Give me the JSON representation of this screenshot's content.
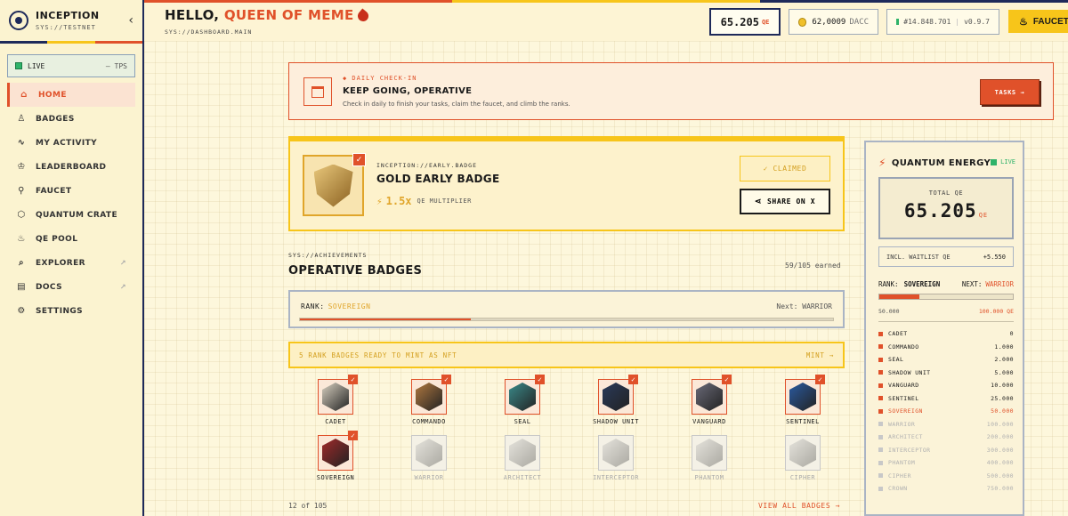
{
  "brand": {
    "title": "INCEPTION",
    "subtitle": "SYS://TESTNET",
    "collapse": "‹"
  },
  "colors": {
    "accent": "#e0512a",
    "gold": "#f7c51a",
    "navy": "#1e2a5a",
    "live": "#2fb36a"
  },
  "status": {
    "live": "LIVE",
    "tps": "— TPS"
  },
  "nav": [
    {
      "label": "HOME",
      "icon": "home-icon",
      "glyph": "⌂",
      "active": true,
      "external": false
    },
    {
      "label": "BADGES",
      "icon": "badge-icon",
      "glyph": "♙",
      "active": false,
      "external": false
    },
    {
      "label": "MY ACTIVITY",
      "icon": "activity-icon",
      "glyph": "∿",
      "active": false,
      "external": false
    },
    {
      "label": "LEADERBOARD",
      "icon": "trophy-icon",
      "glyph": "♔",
      "active": false,
      "external": false
    },
    {
      "label": "FAUCET",
      "icon": "faucet-icon",
      "glyph": "⚲",
      "active": false,
      "external": false
    },
    {
      "label": "QUANTUM CRATE",
      "icon": "cube-icon",
      "glyph": "⬡",
      "active": false,
      "external": false
    },
    {
      "label": "QE POOL",
      "icon": "flame-icon",
      "glyph": "♨",
      "active": false,
      "external": false
    },
    {
      "label": "EXPLORER",
      "icon": "search-icon",
      "glyph": "⌕",
      "active": false,
      "external": true
    },
    {
      "label": "DOCS",
      "icon": "docs-icon",
      "glyph": "▤",
      "active": false,
      "external": true
    },
    {
      "label": "SETTINGS",
      "icon": "gear-icon",
      "glyph": "⚙",
      "active": false,
      "external": false
    }
  ],
  "header": {
    "greeting": "HELLO,",
    "name": "QUEEN OF MEME",
    "path": "SYS://DASHBOARD.MAIN",
    "qe_value": "65.205",
    "qe_unit": "QE",
    "dacc_value": "62,0009",
    "dacc_label": "DACC",
    "block": "#14.848.701",
    "version": "v0.9.7",
    "faucet_label": "FAUCET"
  },
  "checkin": {
    "tag": "◆ DAILY CHECK-IN",
    "title": "KEEP GOING, OPERATIVE",
    "description": "Check in daily to finish your tasks, claim the faucet, and climb the ranks.",
    "button": "TASKS →"
  },
  "early_badge": {
    "path": "INCEPTION://EARLY.BADGE",
    "title": "GOLD EARLY BADGE",
    "multiplier": "1.5x",
    "multiplier_label": "QE MULTIPLIER",
    "claimed": "✓ CLAIMED",
    "share": "SHARE ON X"
  },
  "achievements": {
    "path": "SYS://ACHIEVEMENTS",
    "title": "OPERATIVE BADGES",
    "earned": "59/105 earned",
    "rank_label": "RANK:",
    "rank_value": "SOVEREIGN",
    "next": "Next: WARRIOR",
    "progress": 0.32,
    "mint_text": "5 RANK BADGES READY TO MINT AS NFT",
    "mint_action": "MINT →",
    "count": "12 of 105",
    "view_all": "VIEW ALL BADGES →",
    "badges": [
      {
        "name": "CADET",
        "earned": true,
        "color": "#d8d0c0"
      },
      {
        "name": "COMMANDO",
        "earned": true,
        "color": "#b07840"
      },
      {
        "name": "SEAL",
        "earned": true,
        "color": "#3a8a8a"
      },
      {
        "name": "SHADOW UNIT",
        "earned": true,
        "color": "#2a3a5a"
      },
      {
        "name": "VANGUARD",
        "earned": true,
        "color": "#6a6a78"
      },
      {
        "name": "SENTINEL",
        "earned": true,
        "color": "#2a5aa0"
      },
      {
        "name": "SOVEREIGN",
        "earned": true,
        "color": "#a02a2a"
      },
      {
        "name": "WARRIOR",
        "earned": false,
        "color": "#c8c8c8"
      },
      {
        "name": "ARCHITECT",
        "earned": false,
        "color": "#c8c8c8"
      },
      {
        "name": "INTERCEPTOR",
        "earned": false,
        "color": "#c8c8c8"
      },
      {
        "name": "PHANTOM",
        "earned": false,
        "color": "#c8c8c8"
      },
      {
        "name": "CIPHER",
        "earned": false,
        "color": "#c8c8c8"
      }
    ]
  },
  "quantum": {
    "title": "QUANTUM ENERGY",
    "live": "LIVE",
    "total_label": "TOTAL QE",
    "total_value": "65.205",
    "total_unit": "QE",
    "waitlist_label": "INCL. WAITLIST QE",
    "waitlist_value": "+5.550",
    "rank_label": "RANK:",
    "rank_value": "SOVEREIGN",
    "next_label": "NEXT:",
    "next_value": "WARRIOR",
    "progress": 0.3,
    "range_min": "50.000",
    "range_max": "100.000 QE",
    "tiers": [
      {
        "name": "CADET",
        "value": "0",
        "state": "done"
      },
      {
        "name": "COMMANDO",
        "value": "1.000",
        "state": "done"
      },
      {
        "name": "SEAL",
        "value": "2.000",
        "state": "done"
      },
      {
        "name": "SHADOW UNIT",
        "value": "5.000",
        "state": "done"
      },
      {
        "name": "VANGUARD",
        "value": "10.000",
        "state": "done"
      },
      {
        "name": "SENTINEL",
        "value": "25.000",
        "state": "done"
      },
      {
        "name": "SOVEREIGN",
        "value": "50.000",
        "state": "current"
      },
      {
        "name": "WARRIOR",
        "value": "100.000",
        "state": "locked"
      },
      {
        "name": "ARCHITECT",
        "value": "200.000",
        "state": "locked"
      },
      {
        "name": "INTERCEPTOR",
        "value": "300.000",
        "state": "locked"
      },
      {
        "name": "PHANTOM",
        "value": "400.000",
        "state": "locked"
      },
      {
        "name": "CIPHER",
        "value": "500.000",
        "state": "locked"
      },
      {
        "name": "CROWN",
        "value": "750.000",
        "state": "locked"
      }
    ]
  }
}
